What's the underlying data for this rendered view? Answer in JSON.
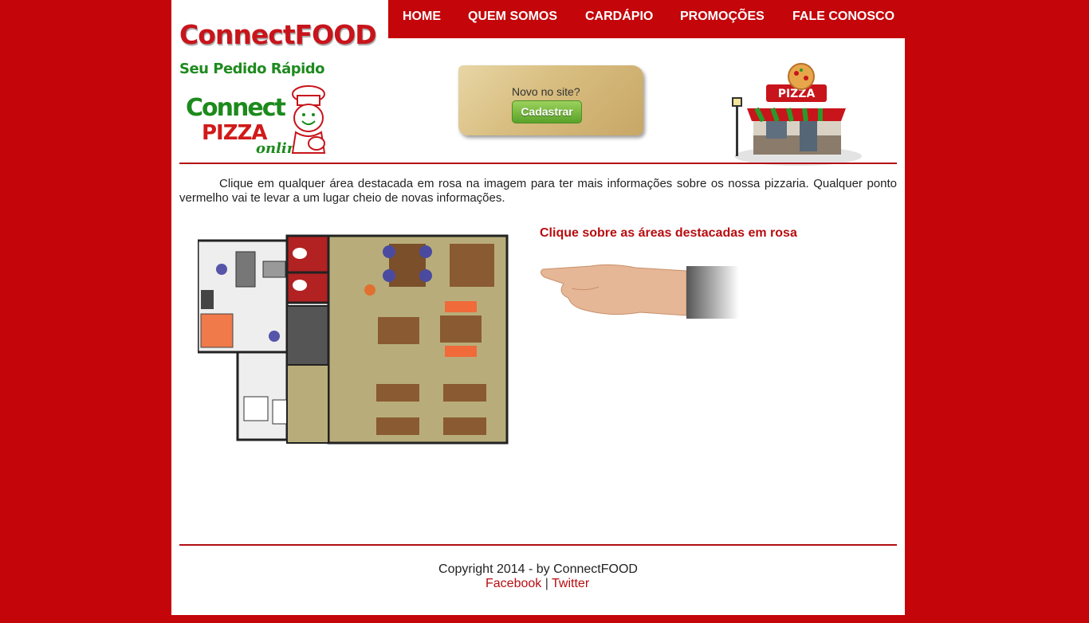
{
  "brand": {
    "name": "ConnectFOOD",
    "tagline": "Seu Pedido Rápido",
    "logo_word1": "Connect",
    "logo_word2": "PIZZA",
    "logo_word3": "online"
  },
  "nav": {
    "items": [
      {
        "label": "HOME"
      },
      {
        "label": "QUEM SOMOS"
      },
      {
        "label": "CARDÁPIO"
      },
      {
        "label": "PROMOÇÕES"
      },
      {
        "label": "FALE CONOSCO"
      }
    ]
  },
  "signup": {
    "prompt": "Novo no site?",
    "button_label": "Cadastrar"
  },
  "shop_sign": "PIZZA",
  "main": {
    "intro": "Clique em qualquer área destacada em rosa na imagem para ter mais informações sobre os nossa pizzaria. Qualquer ponto vermelho vai te levar a um lugar cheio de novas informações.",
    "hint": "Clique sobre as áreas destacadas em rosa"
  },
  "footer": {
    "copyright": "Copyright 2014 - by ConnectFOOD",
    "facebook": "Facebook",
    "separator": "|",
    "twitter": "Twitter"
  },
  "colors": {
    "brand_red": "#c4050a",
    "accent_green": "#1f8a1f",
    "button_green": "#5aa22a"
  }
}
